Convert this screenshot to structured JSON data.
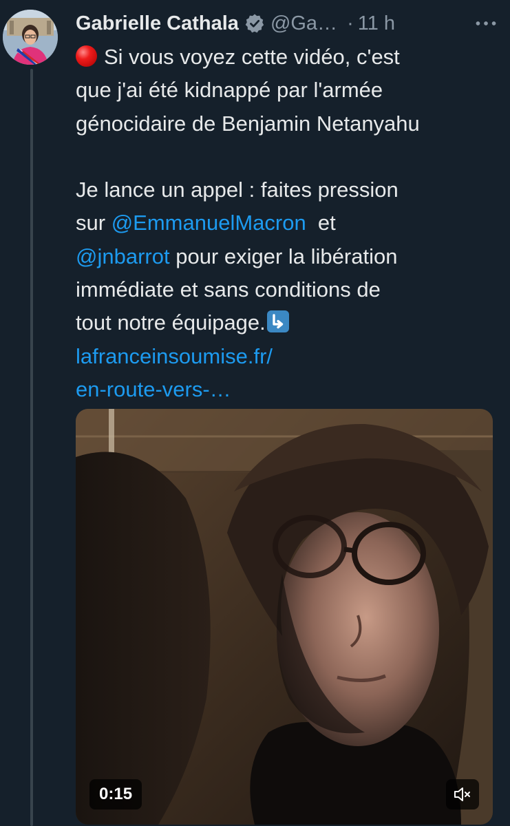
{
  "tweet": {
    "author_name": "Gabrielle Cathala",
    "handle": "@Ga…",
    "separator": "·",
    "time": "11 h",
    "lines": {
      "l1": "Si vous voyez cette vidéo, c'est",
      "l2": "que j'ai été kidnappé par l'armée",
      "l3": "génocidaire de Benjamin Netanyahu",
      "l4": "Je lance un appel : faites pression",
      "l5_pre": "sur ",
      "mention1": "@EmmanuelMacron",
      "l5_post": "  et",
      "mention2": "@jnbarrot",
      "l6_post": " pour exiger la libération",
      "l7": "immédiate et sans conditions de",
      "l8": "tout notre équipage.",
      "link1": "lafranceinsoumise.fr/",
      "link2": "en-route-vers-…"
    },
    "icons": {
      "lead_emoji": "red-circle-icon",
      "trail_emoji": "arrow-down-right-icon",
      "verified": "verified-badge-icon",
      "more": "more-icon"
    }
  },
  "video": {
    "duration": "0:15",
    "mute_icon": "muted-speaker-icon"
  },
  "colors": {
    "background": "#15202b",
    "text": "#e7e9ea",
    "secondary": "#8b98a5",
    "link": "#1d9bf0"
  }
}
